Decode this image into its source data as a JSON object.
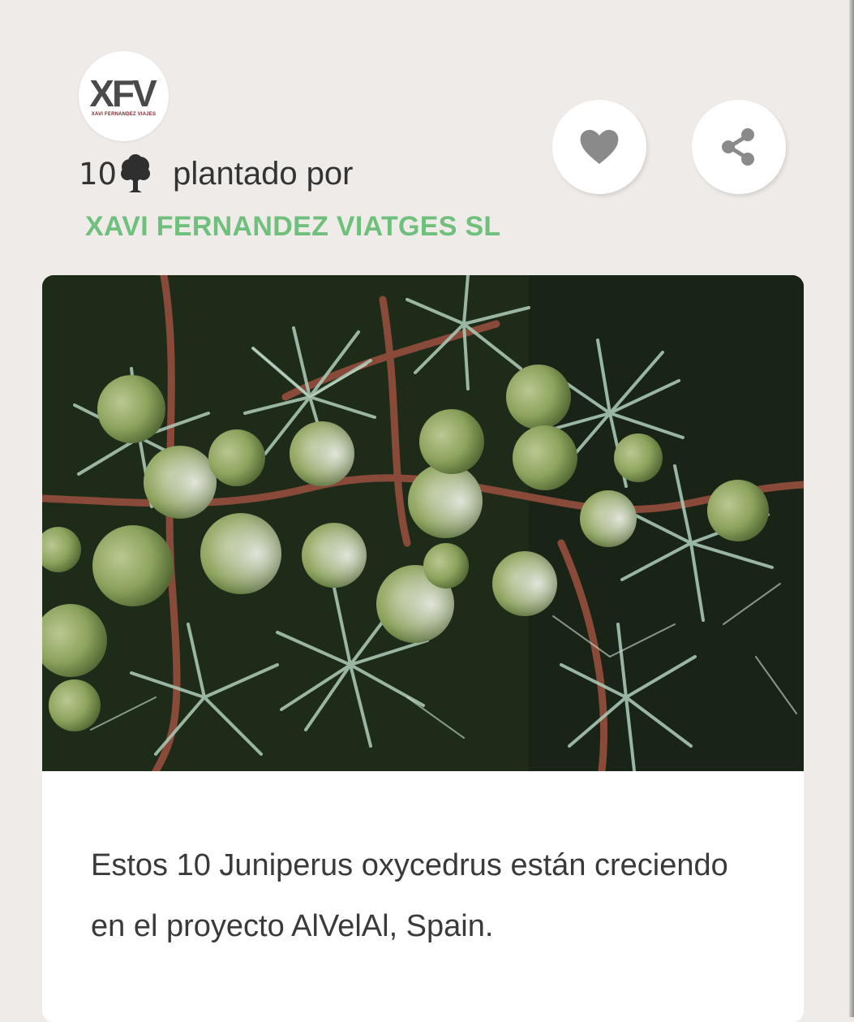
{
  "logo": {
    "mark": "XFV",
    "subtitle": "XAVI FERNANDEZ VIAJES"
  },
  "planting": {
    "count": "10",
    "icon": "tree-icon",
    "label": "plantado por",
    "company": "XAVI FERNANDEZ VIATGES SL"
  },
  "actions": [
    {
      "icon": "heart-icon"
    },
    {
      "icon": "share-icon"
    }
  ],
  "card": {
    "image_subject": "juniper branches with berries",
    "description": "Estos 10 Juniperus oxycedrus están creciendo en el proyecto AlVelAl, Spain."
  },
  "colors": {
    "background": "#efebe8",
    "accent_green": "#6fc07d",
    "icon_gray": "#8a8a8a"
  }
}
